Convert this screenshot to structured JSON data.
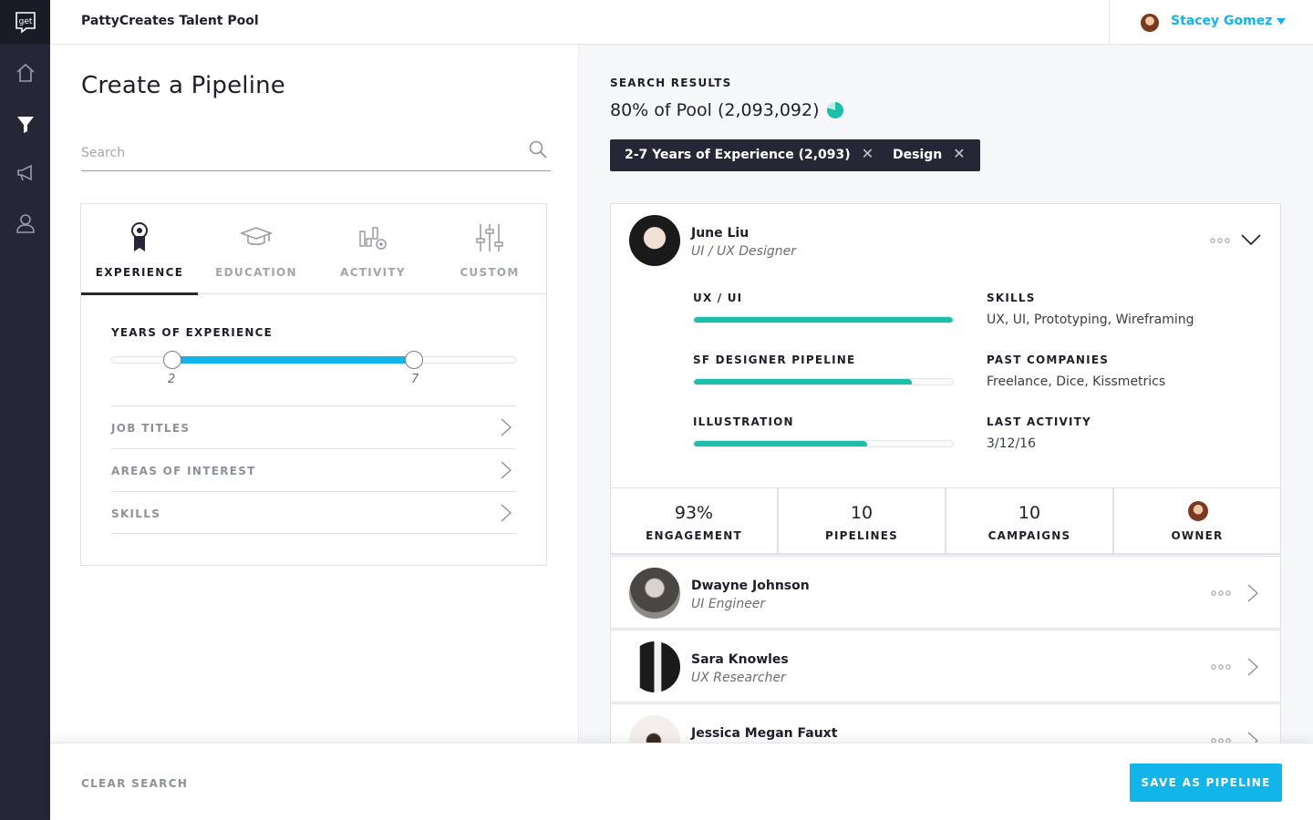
{
  "app": {
    "title": "PattyCreates Talent Pool",
    "logo_text": "get"
  },
  "user": {
    "name": "Stacey Gomez"
  },
  "left": {
    "heading": "Create a Pipeline",
    "search_placeholder": "Search",
    "tabs": [
      {
        "label": "EXPERIENCE",
        "icon": "award-ribbon-icon",
        "active": true
      },
      {
        "label": "EDUCATION",
        "icon": "graduation-cap-icon",
        "active": false
      },
      {
        "label": "ACTIVITY",
        "icon": "activity-chart-gear-icon",
        "active": false
      },
      {
        "label": "CUSTOM",
        "icon": "sliders-icon",
        "active": false
      }
    ],
    "years_label": "YEARS OF EXPERIENCE",
    "range_min": "2",
    "range_max": "7",
    "filters": [
      "JOB TITLES",
      "AREAS OF INTEREST",
      "SKILLS"
    ]
  },
  "results": {
    "label": "SEARCH RESULTS",
    "count": "80% of Pool (2,093,092)",
    "pool_fraction": 0.8,
    "chips": [
      {
        "label": "2-7 Years of Experience (2,093)"
      },
      {
        "label": "Design"
      }
    ],
    "expanded": {
      "name": "June Liu",
      "role": "UI / UX Designer",
      "metrics": [
        {
          "label": "UX / UI",
          "value": 1.0
        },
        {
          "label": "SF DESIGNER PIPELINE",
          "value": 0.84
        },
        {
          "label": "ILLUSTRATION",
          "value": 0.67
        }
      ],
      "info": [
        {
          "label": "SKILLS",
          "value": "UX, UI, Prototyping, Wireframing"
        },
        {
          "label": "PAST COMPANIES",
          "value": "Freelance, Dice,  Kissmetrics"
        },
        {
          "label": "LAST ACTIVITY",
          "value": "3/12/16"
        }
      ],
      "stats": [
        {
          "value": "93%",
          "label": "ENGAGEMENT"
        },
        {
          "value": "10",
          "label": "PIPELINES"
        },
        {
          "value": "10",
          "label": "CAMPAIGNS"
        },
        {
          "value": "",
          "label": "OWNER"
        }
      ]
    },
    "people": [
      {
        "name": "Dwayne Johnson",
        "role": "UI Engineer"
      },
      {
        "name": "Sara Knowles",
        "role": "UX Researcher"
      },
      {
        "name": "Jessica Megan Fauxt",
        "role": ""
      }
    ]
  },
  "footer": {
    "clear_label": "CLEAR SEARCH",
    "save_label": "SAVE AS PIPELINE"
  },
  "colors": {
    "accent": "#12b5ea",
    "teal": "#1bbfaa",
    "rail": "#262636"
  }
}
